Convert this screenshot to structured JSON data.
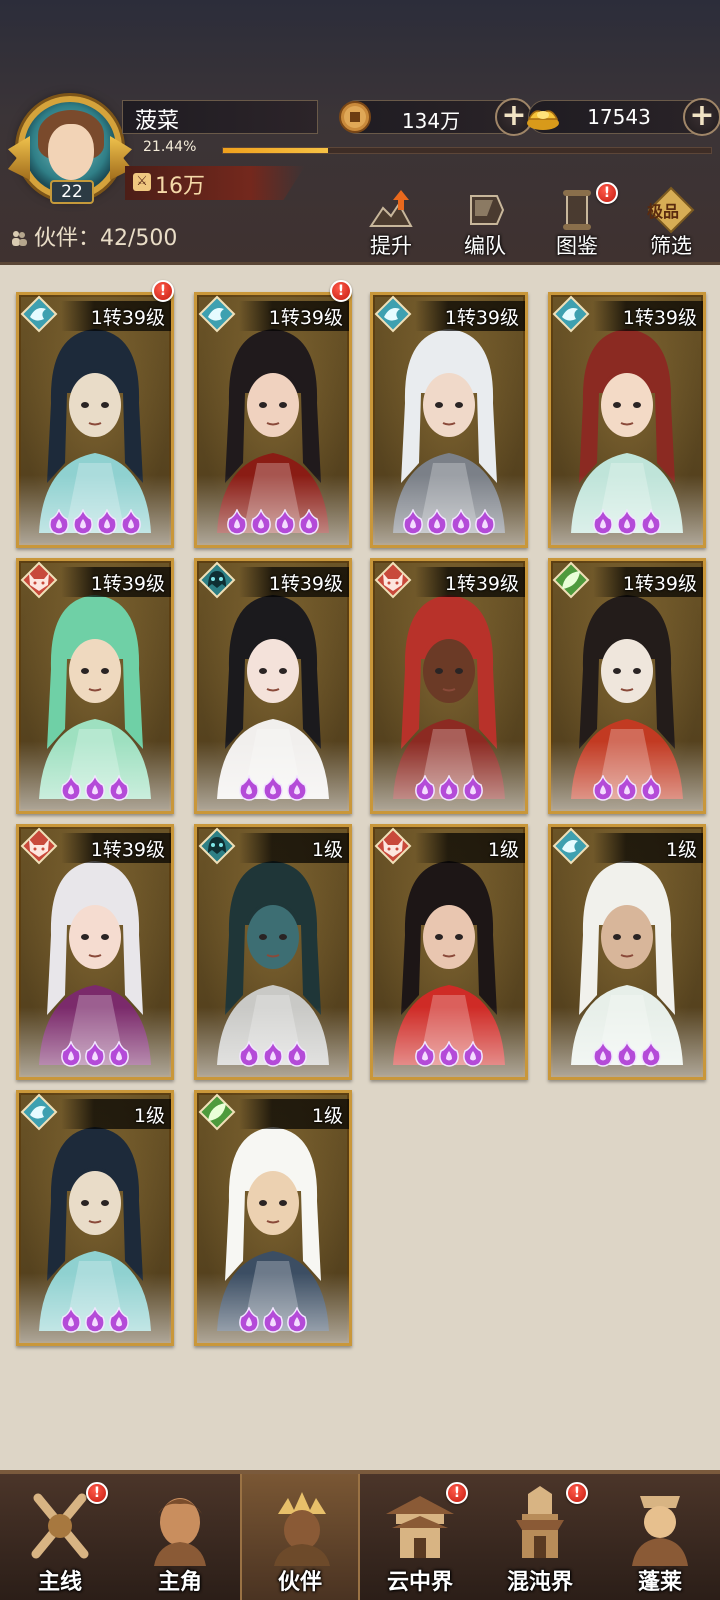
{
  "player": {
    "name": "菠菜",
    "level": "22",
    "exp_text": "21.44%",
    "exp_fraction": 0.2144,
    "power": "16万"
  },
  "currencies": {
    "coins": "134万",
    "gold": "17543"
  },
  "partner_count": "伙伴：42/500",
  "top_buttons": [
    {
      "label": "提升",
      "icon": "upgrade-icon",
      "alert": false
    },
    {
      "label": "编队",
      "icon": "formation-icon",
      "alert": false
    },
    {
      "label": "图鉴",
      "icon": "codex-icon",
      "alert": true
    },
    {
      "label": "筛选",
      "icon": "filter-icon",
      "badge": "极品",
      "alert": false
    }
  ],
  "cards": [
    {
      "level": "1转39级",
      "element": "wind",
      "stars": 4,
      "alert": true,
      "palette": {
        "hair": "#1d2a3a",
        "robe": "#8fd1d0",
        "skin": "#e9dcc8"
      }
    },
    {
      "level": "1转39级",
      "element": "wind",
      "stars": 4,
      "alert": true,
      "palette": {
        "hair": "#201a1c",
        "robe": "#8a1c14",
        "skin": "#f0d2bf"
      }
    },
    {
      "level": "1转39级",
      "element": "wind",
      "stars": 4,
      "alert": false,
      "palette": {
        "hair": "#e9ecef",
        "robe": "#7b8088",
        "skin": "#f0d9c9"
      }
    },
    {
      "level": "1转39级",
      "element": "wind",
      "stars": 3,
      "alert": false,
      "palette": {
        "hair": "#8b2a22",
        "robe": "#bfe4d9",
        "skin": "#f3dac6"
      }
    },
    {
      "level": "1转39级",
      "element": "fox",
      "stars": 3,
      "alert": false,
      "palette": {
        "hair": "#6fd0a6",
        "robe": "#9ee0c0",
        "skin": "#efd9bf"
      }
    },
    {
      "level": "1转39级",
      "element": "ghost",
      "stars": 3,
      "alert": false,
      "palette": {
        "hair": "#1b1a1d",
        "robe": "#f1efed",
        "skin": "#f4e2da"
      }
    },
    {
      "level": "1转39级",
      "element": "fox",
      "stars": 3,
      "alert": false,
      "palette": {
        "hair": "#b8322a",
        "robe": "#8c2a22",
        "skin": "#6b3a26"
      }
    },
    {
      "level": "1转39级",
      "element": "leaf",
      "stars": 3,
      "alert": false,
      "palette": {
        "hair": "#231c1a",
        "robe": "#c23a22",
        "skin": "#efe6dc"
      }
    },
    {
      "level": "1转39级",
      "element": "fox",
      "stars": 3,
      "alert": false,
      "palette": {
        "hair": "#e8e6ea",
        "robe": "#7b2a6b",
        "skin": "#f5dcd0"
      }
    },
    {
      "level": "1级",
      "element": "ghost",
      "stars": 3,
      "alert": false,
      "palette": {
        "hair": "#1f3638",
        "robe": "#c9c9c6",
        "skin": "#3d6e73"
      }
    },
    {
      "level": "1级",
      "element": "fox",
      "stars": 3,
      "alert": false,
      "palette": {
        "hair": "#1d1616",
        "robe": "#cf2b26",
        "skin": "#e9c6b0"
      }
    },
    {
      "level": "1级",
      "element": "wind",
      "stars": 3,
      "alert": false,
      "palette": {
        "hair": "#f1f1ec",
        "robe": "#e7efe9",
        "skin": "#d8b69a"
      }
    },
    {
      "level": "1级",
      "element": "wind",
      "stars": 3,
      "alert": false,
      "palette": {
        "hair": "#1d2a3a",
        "robe": "#8fd1d0",
        "skin": "#e9dcc8"
      }
    },
    {
      "level": "1级",
      "element": "leaf",
      "stars": 3,
      "alert": false,
      "palette": {
        "hair": "#f7f7f3",
        "robe": "#3c4e63",
        "skin": "#ecd1b1"
      }
    }
  ],
  "bottom_nav": [
    {
      "label": "主线",
      "icon": "main-quest-icon",
      "alert": true,
      "active": false
    },
    {
      "label": "主角",
      "icon": "hero-icon",
      "alert": false,
      "active": false
    },
    {
      "label": "伙伴",
      "icon": "partner-icon",
      "alert": false,
      "active": true
    },
    {
      "label": "云中界",
      "icon": "cloud-realm-icon",
      "alert": true,
      "active": false
    },
    {
      "label": "混沌界",
      "icon": "chaos-realm-icon",
      "alert": true,
      "active": false
    },
    {
      "label": "蓬莱",
      "icon": "penglai-icon",
      "alert": false,
      "active": false
    }
  ],
  "colors": {
    "card_border": "#c9973a",
    "alert_red": "#d7281b",
    "flame_purple": "#b44bd8",
    "exp_fill": "#f4b12a"
  }
}
